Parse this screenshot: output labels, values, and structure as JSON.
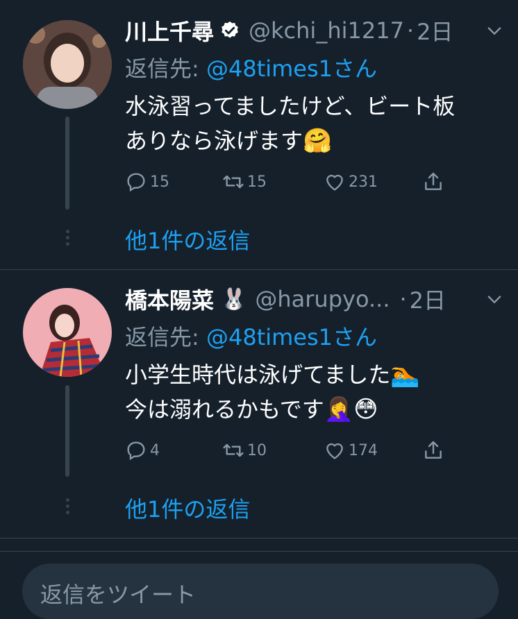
{
  "tweets": [
    {
      "name": "川上千尋",
      "verified": true,
      "handle": "@kchi_hi1217",
      "separator": "·",
      "time": "2日",
      "reply_prefix": "返信先: ",
      "reply_mention": "@48times1さん",
      "body_line1": "水泳習ってましたけど、ビート板",
      "body_line2": "ありなら泳げます",
      "body_emoji": "🤗",
      "reply_count": "15",
      "retweet_count": "15",
      "like_count": "231",
      "more_replies": "他1件の返信"
    },
    {
      "name": "橋本陽菜",
      "name_emoji": "🐰",
      "handle": "@harupyo...",
      "separator": "·",
      "time": "2日",
      "reply_prefix": "返信先: ",
      "reply_mention": "@48times1さん",
      "body_line1": "小学生時代は泳げてました",
      "body_line1_emoji": "🏊",
      "body_line2": "今は溺れるかもです",
      "body_line2_emoji": "🤦‍♀️😳",
      "reply_count": "4",
      "retweet_count": "10",
      "like_count": "174",
      "more_replies": "他1件の返信"
    }
  ],
  "composer": {
    "placeholder": "返信をツイート"
  },
  "colors": {
    "background": "#15202b",
    "accent": "#1da1f2",
    "muted": "#8899a6",
    "border": "#38444d"
  },
  "icons": [
    "verified-badge-icon",
    "chevron-down-icon",
    "reply-icon",
    "retweet-icon",
    "like-icon",
    "share-icon"
  ]
}
